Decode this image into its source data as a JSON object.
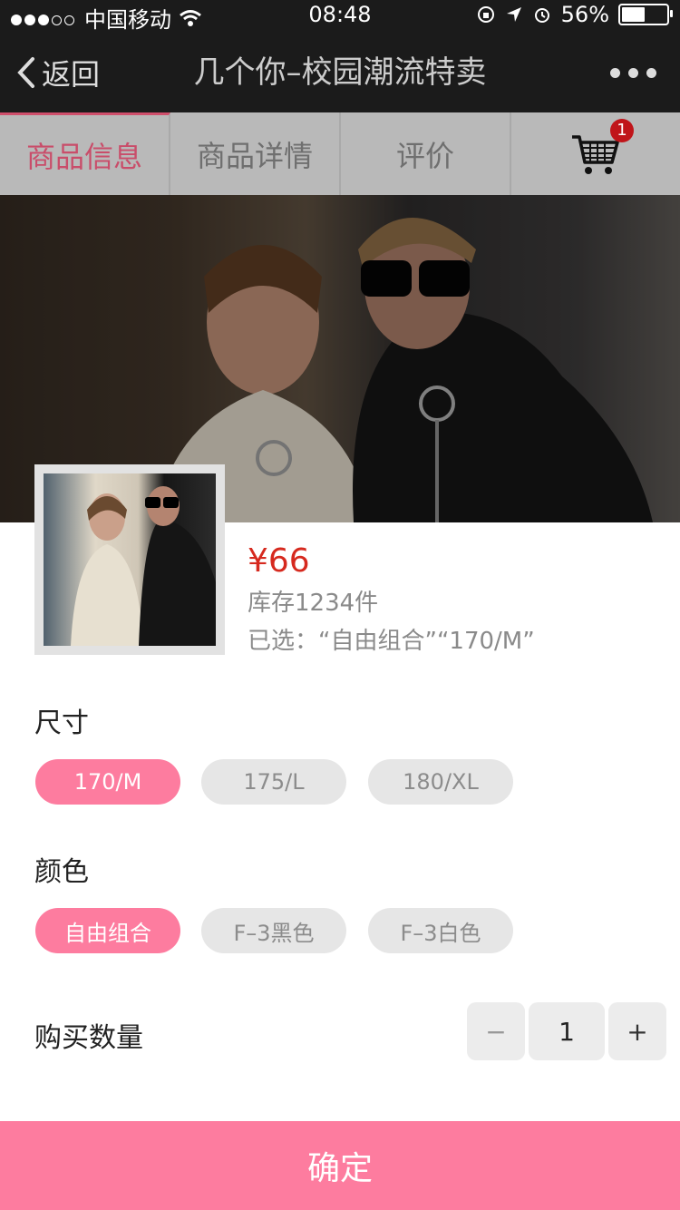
{
  "status_bar": {
    "carrier": "中国移动",
    "time": "08:48",
    "battery": "56%",
    "battery_level": 0.56,
    "signal_bars": 3
  },
  "nav": {
    "back_label": "返回",
    "title": "几个你–校园潮流特卖"
  },
  "tabs": [
    {
      "label": "商品信息",
      "active": true
    },
    {
      "label": "商品详情",
      "active": false
    },
    {
      "label": "评价",
      "active": false
    }
  ],
  "cart": {
    "count": "1"
  },
  "product": {
    "price": "¥66",
    "stock": "库存1234件",
    "selected": "已选：“自由组合”“170/M”"
  },
  "size": {
    "label": "尺寸",
    "options": [
      "170/M",
      "175/L",
      "180/XL"
    ],
    "selected_index": 0
  },
  "color": {
    "label": "颜色",
    "options": [
      "自由组合",
      "F–3黑色",
      "F–3白色"
    ],
    "selected_index": 0
  },
  "quantity": {
    "label": "购买数量",
    "value": "1",
    "minus": "−",
    "plus": "+"
  },
  "confirm_label": "确定",
  "colors": {
    "accent": "#fd7c9f",
    "price": "#d6291e",
    "badge": "#c0151a"
  }
}
